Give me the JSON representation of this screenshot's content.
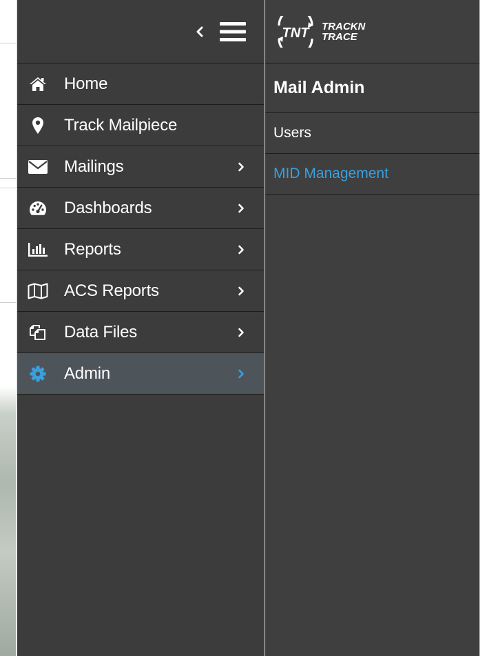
{
  "brand": {
    "logo_mark": "TNT",
    "logo_line1": "TRACKN",
    "logo_line2": "TRACE"
  },
  "header": {
    "collapse_icon": "chevron-left-icon",
    "menu_icon": "hamburger-menu-icon"
  },
  "nav": {
    "items": [
      {
        "label": "Home",
        "icon": "home-icon",
        "has_submenu": false,
        "active": false
      },
      {
        "label": "Track Mailpiece",
        "icon": "map-marker-icon",
        "has_submenu": false,
        "active": false
      },
      {
        "label": "Mailings",
        "icon": "envelope-icon",
        "has_submenu": true,
        "active": false
      },
      {
        "label": "Dashboards",
        "icon": "dashboard-gauge-icon",
        "has_submenu": true,
        "active": false
      },
      {
        "label": "Reports",
        "icon": "bar-chart-icon",
        "has_submenu": true,
        "active": false
      },
      {
        "label": "ACS Reports",
        "icon": "map-icon",
        "has_submenu": true,
        "active": false
      },
      {
        "label": "Data Files",
        "icon": "copy-files-icon",
        "has_submenu": true,
        "active": false
      },
      {
        "label": "Admin",
        "icon": "gear-icon",
        "has_submenu": true,
        "active": true
      }
    ]
  },
  "submenu": {
    "title": "Mail Admin",
    "items": [
      {
        "label": "Users",
        "active": false
      },
      {
        "label": "MID Management",
        "active": true
      }
    ]
  },
  "colors": {
    "sidebar_bg": "#3c3c3c",
    "active_row_bg": "#4d545a",
    "accent": "#3aa0dc",
    "text": "#ffffff"
  }
}
